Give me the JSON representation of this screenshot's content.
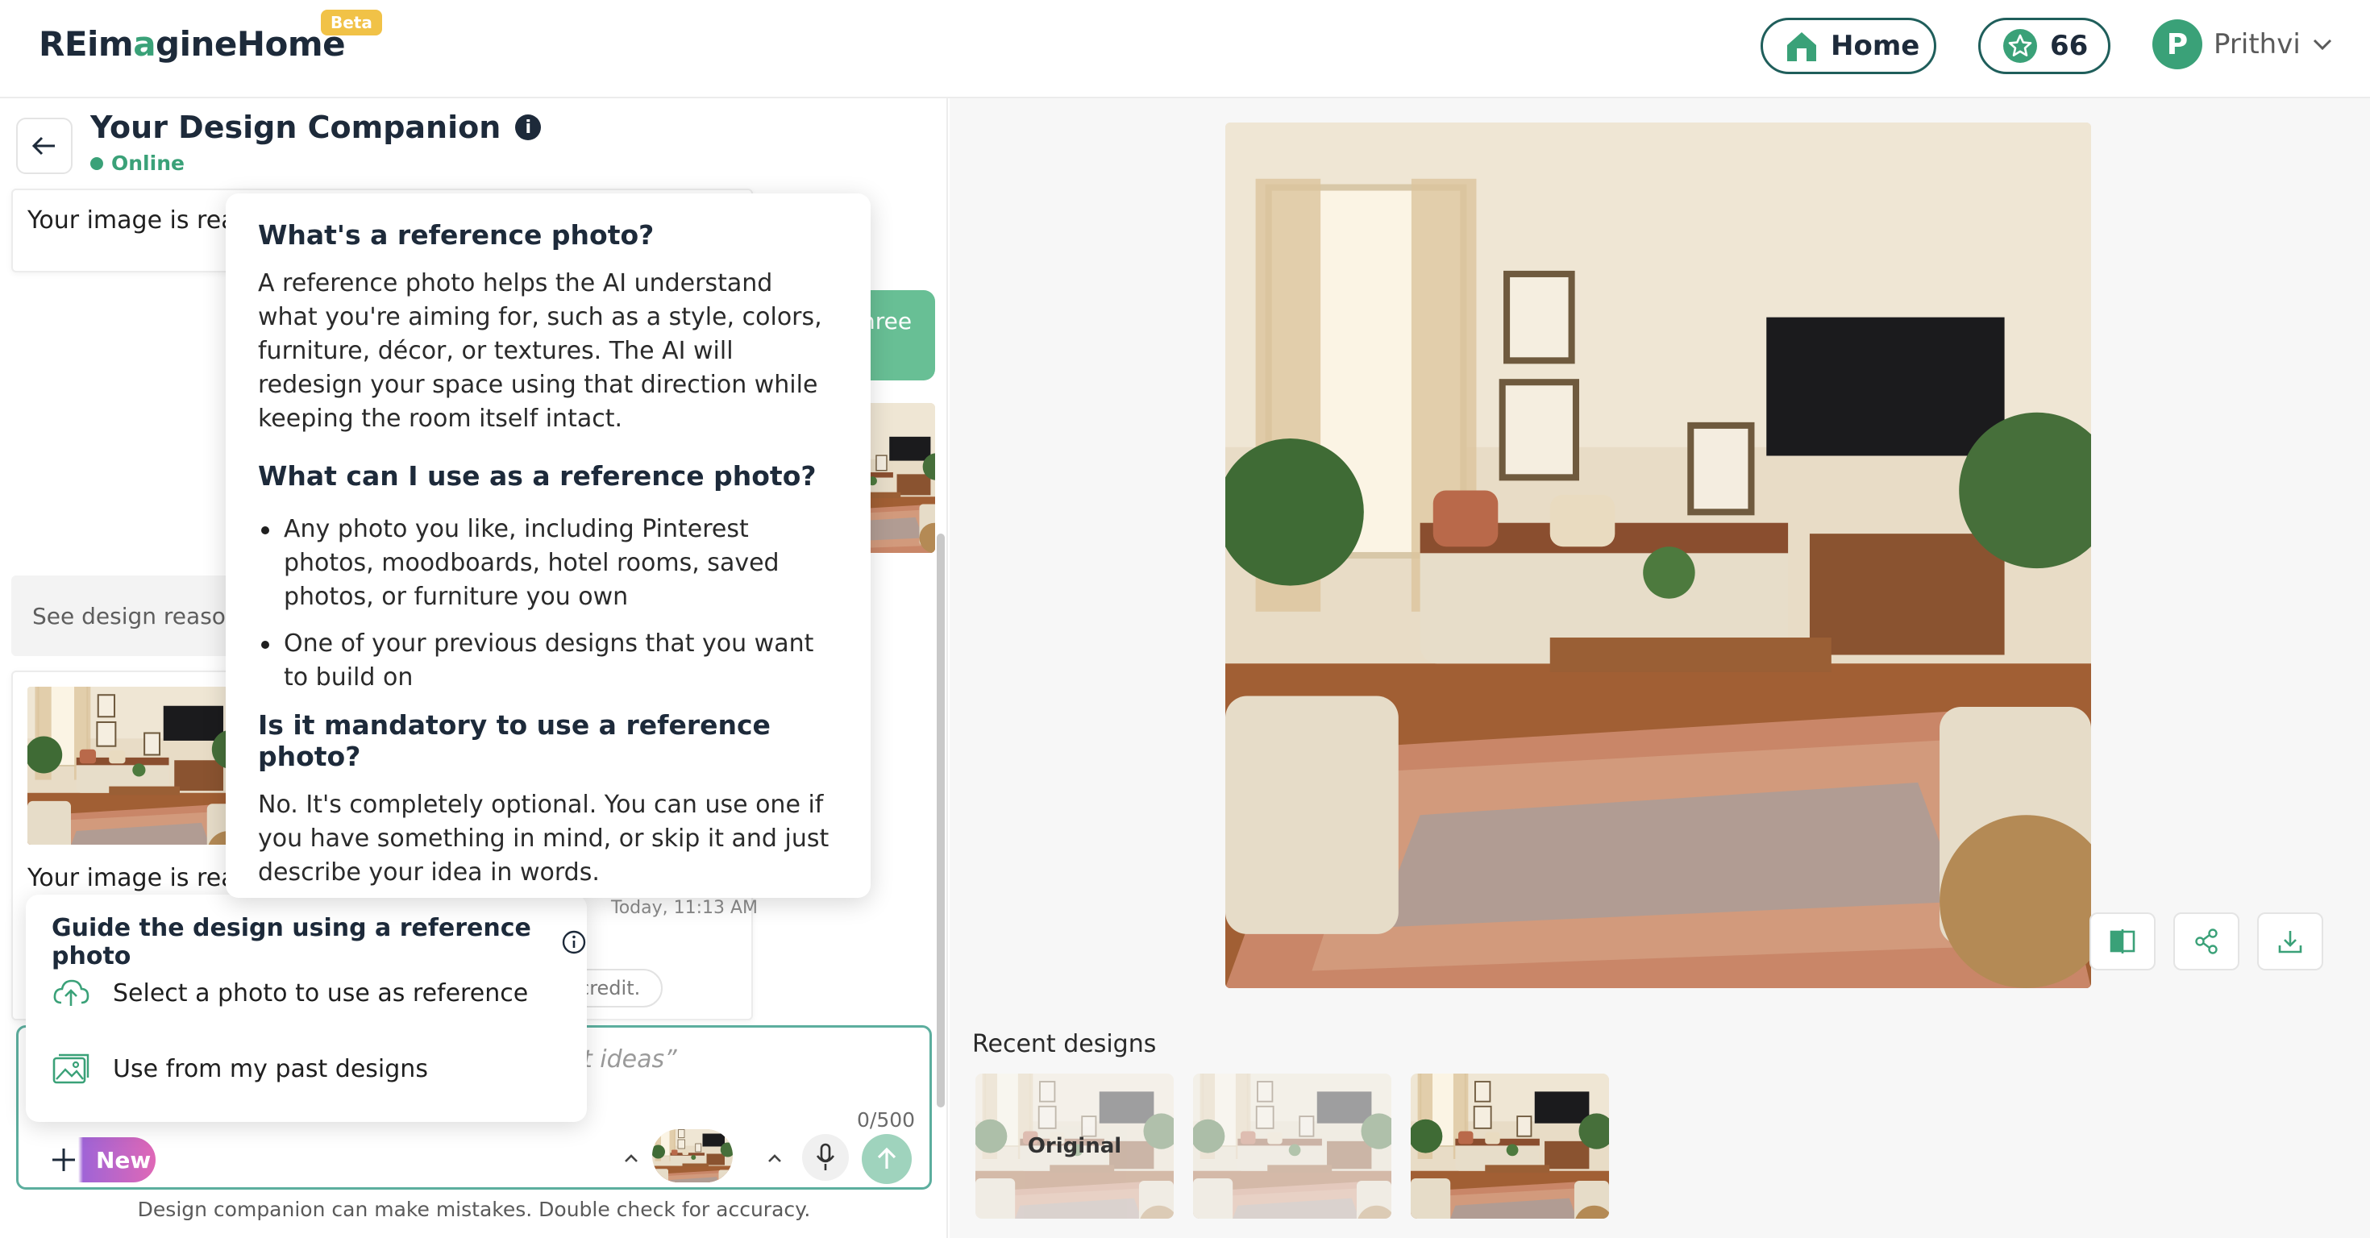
{
  "header": {
    "logo_part1": "REim",
    "logo_accent": "a",
    "logo_part2": "gineHome",
    "beta": "Beta",
    "home_label": "Home",
    "credits": "66",
    "avatar_initial": "P",
    "user_name": "Prithvi"
  },
  "chat": {
    "title": "Your Design Companion",
    "info": "i",
    "status": "Online",
    "msg1_text": "Your image is rea",
    "green_bubble_text": "hree",
    "reasoning_text": "See design reasor",
    "msg2_text": "Your image is rea",
    "timestamp": "Today, 11:13 AM",
    "credit_chip": "credit.",
    "composer_placeholder": "t ideas”",
    "counter": "0/500",
    "new_label": "New",
    "disclaimer": "Design companion can make mistakes. Double check for accuracy."
  },
  "popover": {
    "h1": "What's a reference photo?",
    "p1": "A reference photo helps the AI understand what you're aiming for, such as a style, colors, furniture, décor, or textures. The AI will redesign your space using that direction while keeping the room itself intact.",
    "h2": "What can I use as a reference photo?",
    "li1": "Any photo you like, including Pinterest photos, moodboards, hotel rooms, saved photos, or furniture you own",
    "li2": "One of your previous designs that you want to build on",
    "h3": "Is it mandatory to use a reference photo?",
    "p3": "No. It's completely optional. You can use one if you have something in mind, or skip it and just describe your idea in words."
  },
  "guide": {
    "title": "Guide the design using a reference photo",
    "item1": "Select a photo to use as reference",
    "item2": "Use from my past designs"
  },
  "recent": {
    "label": "Recent designs",
    "original_label": "Original"
  },
  "colors": {
    "brand_green": "#3aa178",
    "brand_dark": "#1f5e5b",
    "bubble_green": "#68bf95",
    "send_green": "#9fd3bd",
    "new_gradient_start": "#a064d6",
    "new_gradient_end": "#df68b6",
    "beta_yellow": "#f1c247"
  }
}
